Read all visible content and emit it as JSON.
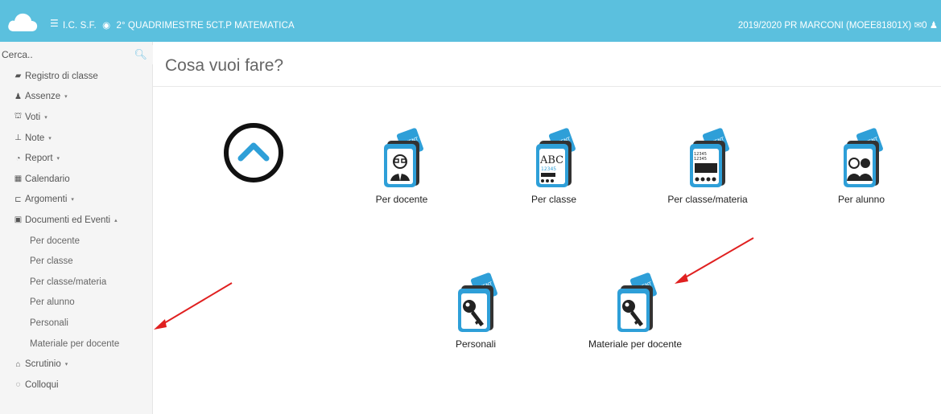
{
  "topbar": {
    "context_text": "I.C. S.F.",
    "period_text": "2° QUADRIMESTRE  5CT.P  MATEMATICA",
    "right_text": "2019/2020  PR MARCONI (MOEE81801X)",
    "mail_count": "0",
    "bg_color": "#5bc0de"
  },
  "search": {
    "placeholder": "Cerca.."
  },
  "sidebar": {
    "items": [
      {
        "label": "Registro di classe",
        "icon": "book-icon",
        "caret": ""
      },
      {
        "label": "Assenze",
        "icon": "user-icon",
        "caret": "▾"
      },
      {
        "label": "Voti",
        "icon": "bank-icon",
        "caret": "▾"
      },
      {
        "label": "Note",
        "icon": "pin-icon",
        "caret": "▾"
      },
      {
        "label": "Report",
        "icon": "pie-chart-icon",
        "caret": "▾"
      },
      {
        "label": "Calendario",
        "icon": "calendar-icon",
        "caret": ""
      },
      {
        "label": "Argomenti",
        "icon": "folder-open-icon",
        "caret": "▾"
      },
      {
        "label": "Documenti ed Eventi",
        "icon": "archive-icon",
        "caret": "▴"
      }
    ],
    "subitems": [
      {
        "label": "Per docente"
      },
      {
        "label": "Per classe"
      },
      {
        "label": "Per classe/materia"
      },
      {
        "label": "Per alunno"
      },
      {
        "label": "Personali"
      },
      {
        "label": "Materiale per docente"
      }
    ],
    "bottom_items": [
      {
        "label": "Scrutinio",
        "icon": "graduation-cap-icon",
        "caret": "▾"
      },
      {
        "label": "Colloqui",
        "icon": "chat-icon",
        "caret": ""
      }
    ]
  },
  "main": {
    "heading": "Cosa vuoi fare?",
    "tiles": [
      {
        "label": "Per docente",
        "icon": "teacher-event-icon"
      },
      {
        "label": "Per classe",
        "icon": "class-event-icon"
      },
      {
        "label": "Per classe/materia",
        "icon": "class-subject-event-icon"
      },
      {
        "label": "Per alunno",
        "icon": "student-event-icon"
      },
      {
        "label": "Personali",
        "icon": "key-event-icon"
      },
      {
        "label": "Materiale per docente",
        "icon": "key-event-icon"
      }
    ],
    "badge_text": "EVENT",
    "icon_text_abc": "ABC",
    "icon_text_digits": "12345"
  },
  "colors": {
    "accent": "#5bc0de",
    "icon_blue": "#2e9fd8",
    "arrow_red": "#e02020"
  }
}
